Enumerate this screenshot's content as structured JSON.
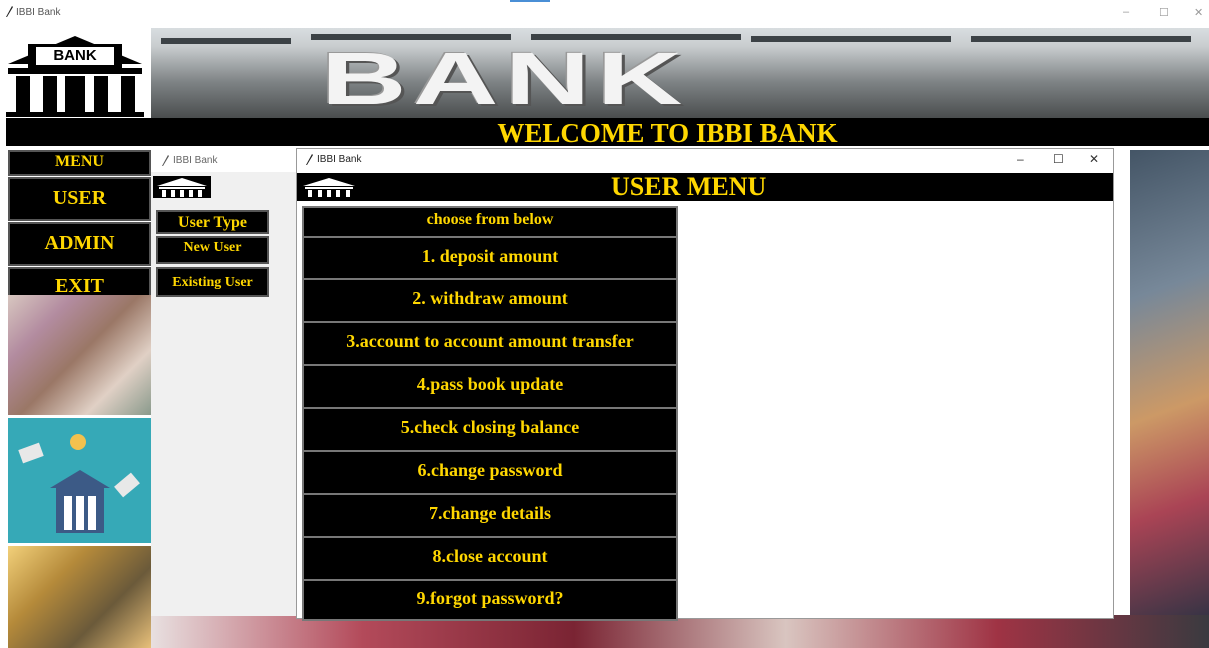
{
  "main_window": {
    "title": "IBBI Bank"
  },
  "banner": {
    "logo_text": "BANK",
    "word": "BANK",
    "welcome": "WELCOME TO IBBI BANK"
  },
  "left_menu": {
    "header": "MENU",
    "items": [
      "USER",
      "ADMIN",
      "EXIT"
    ]
  },
  "user_type_window": {
    "title": "IBBI Bank",
    "header": "User Type",
    "items": [
      "New User",
      "Existing User"
    ]
  },
  "user_menu_window": {
    "title": "IBBI Bank",
    "heading": "USER MENU",
    "subheading": "choose from below",
    "options": [
      "1. deposit amount",
      "2. withdraw amount",
      "3.account to account amount transfer",
      "4.pass book update",
      "5.check closing balance",
      "6.change password",
      "7.change details",
      "8.close account",
      "9.forgot password?"
    ],
    "controls": {
      "minimize": "–",
      "maximize": "☐",
      "close": "✕"
    }
  },
  "colors": {
    "accent": "#ffd700",
    "bar": "#000000"
  }
}
